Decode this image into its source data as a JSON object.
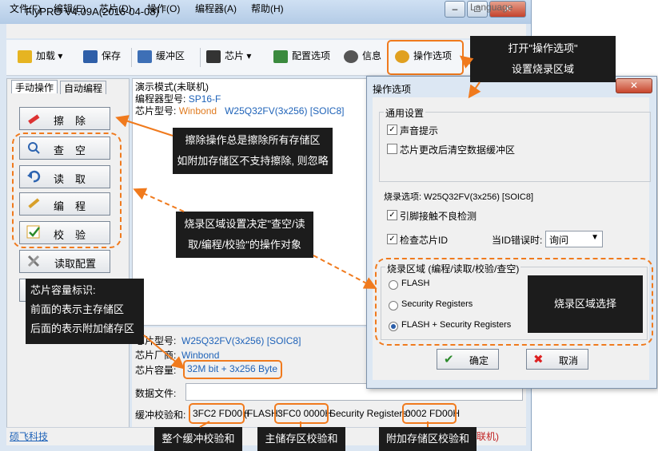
{
  "window": {
    "title": "FlyPRO V4.09A(2016-04-08)",
    "min": "–",
    "max": "□",
    "close": "✕"
  },
  "menu": {
    "items": [
      "文件(F)",
      "编辑(E)",
      "芯片(D)",
      "操作(O)",
      "编程器(A)",
      "帮助(H)"
    ],
    "language": "Language"
  },
  "toolbar": {
    "load": "加载",
    "save": "保存",
    "buffer": "缓冲区",
    "chip": "芯片",
    "config": "配置选项",
    "info": "信息",
    "ops": "操作选项"
  },
  "tabs": {
    "manual": "手动操作",
    "auto": "自动编程"
  },
  "ops": {
    "erase": "擦除",
    "blank": "查空",
    "read": "读取",
    "program": "编程",
    "verify": "校验",
    "read_config": "读取配置"
  },
  "log": {
    "line1": "演示模式(未联机)",
    "prog_label": "编程器型号:",
    "prog_value": "SP16-F",
    "chip_label": "芯片型号:",
    "chip_vendor": "Winbond",
    "chip_value": "W25Q32FV(3x256) [SOIC8]"
  },
  "info": {
    "chip_label": "芯片型号:",
    "chip_value": "W25Q32FV(3x256) [SOIC8]",
    "vendor_label": "芯片厂商:",
    "vendor_value": "Winbond",
    "cap_label": "芯片容量:",
    "cap_value": "32M bit + 3x256 Byte",
    "file_label": "数据文件:",
    "cs_label": "缓冲校验和:",
    "cs_total": "3FC2 FD00H",
    "cs_flash_label": "(FLASH:",
    "cs_flash": "3FC0 0000H",
    "cs_sr_label": "Security Registers:",
    "cs_sr": "0002 FD00H"
  },
  "status": {
    "company": "硕飞科技",
    "right": "联机)"
  },
  "dialog": {
    "title": "操作选项",
    "close": "✕",
    "general_title": "通用设置",
    "opt_beep": "声音提示",
    "opt_clear": "芯片更改后清空数据缓冲区",
    "burn_title": "烧录选项:  W25Q32FV(3x256) [SOIC8]",
    "opt_pin": "引脚接触不良检测",
    "opt_id": "检查芯片ID",
    "id_err_label": "当ID错误时:",
    "id_err_value": "询问",
    "region_title": "烧录区域 (编程/读取/校验/查空)",
    "region_flash": "FLASH",
    "region_sr": "Security Registers",
    "region_both": "FLASH + Security Registers",
    "ok": "确定",
    "cancel": "取消"
  },
  "callouts": {
    "open_ops_1": "打开\"操作选项\"",
    "open_ops_2": "设置烧录区域",
    "erase_1": "擦除操作总是擦除所有存储区",
    "erase_2": "如附加存储区不支持擦除, 则忽略",
    "region_1": "烧录区域设置决定\"查空/读",
    "region_2": "取/编程/校验\"的操作对象",
    "cap_1": "芯片容量标识:",
    "cap_2": "前面的表示主存储区",
    "cap_3": "后面的表示附加储存区",
    "region_select": "烧录区域选择",
    "cs_total": "整个缓冲校验和",
    "cs_main": "主储存区校验和",
    "cs_extra": "附加存储区校验和"
  },
  "colors": {
    "accent": "#f07a1d",
    "link": "#1e62b8",
    "callout_bg": "#1c1c1c"
  }
}
